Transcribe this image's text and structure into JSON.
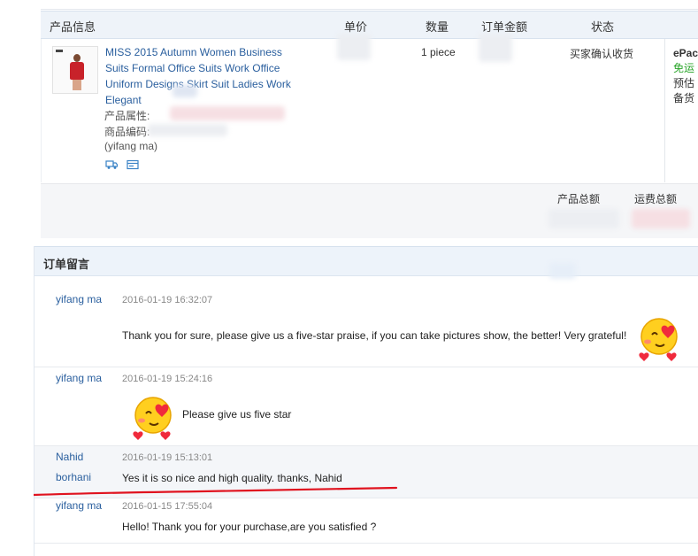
{
  "order": {
    "headers": {
      "product_info": "产品信息",
      "unit_price": "单价",
      "quantity": "数量",
      "order_amount": "订单金额",
      "status": "状态"
    },
    "product": {
      "title_lines": [
        "MISS 2015 Autumn Women Business",
        "Suits Formal Office Suits Work Office",
        "Uniform Designs Skirt Suit Ladies Work",
        "Elegant"
      ],
      "attr_label": "产品属性:",
      "sku_label": "商品编码:",
      "seller": "(yifang ma)",
      "quantity": "1 piece",
      "status": "买家确认收货",
      "shipping_lines": [
        "ePac",
        "免运",
        "预估",
        "备货"
      ]
    },
    "footer": {
      "product_total_label": "产品总额",
      "shipping_fee_label": "运费总额"
    }
  },
  "messages": {
    "header": "订单留言",
    "items": [
      {
        "author": "yifang ma",
        "time": "2016-01-19 16:32:07",
        "text": "Thank you for sure, please give us a five-star praise, if you can take pictures show, the better! Very grateful!"
      },
      {
        "author": "yifang ma",
        "time": "2016-01-19 15:24:16",
        "text": "Please give us five star"
      },
      {
        "author_lines": [
          "Nahid",
          "borhani"
        ],
        "time": "2016-01-19 15:13:01",
        "text": "Yes it is so nice and high quality. thanks, Nahid"
      },
      {
        "author": "yifang ma",
        "time": "2016-01-15 17:55:04",
        "text": "Hello! Thank you for your purchase,are you satisfied ?"
      }
    ]
  },
  "colors": {
    "link": "#2a5f9e",
    "shipping_free": "#2aa52a",
    "annotation": "#e0131f"
  },
  "icons": [
    "logistics-icon",
    "card-icon",
    "love-emoji-icon"
  ]
}
